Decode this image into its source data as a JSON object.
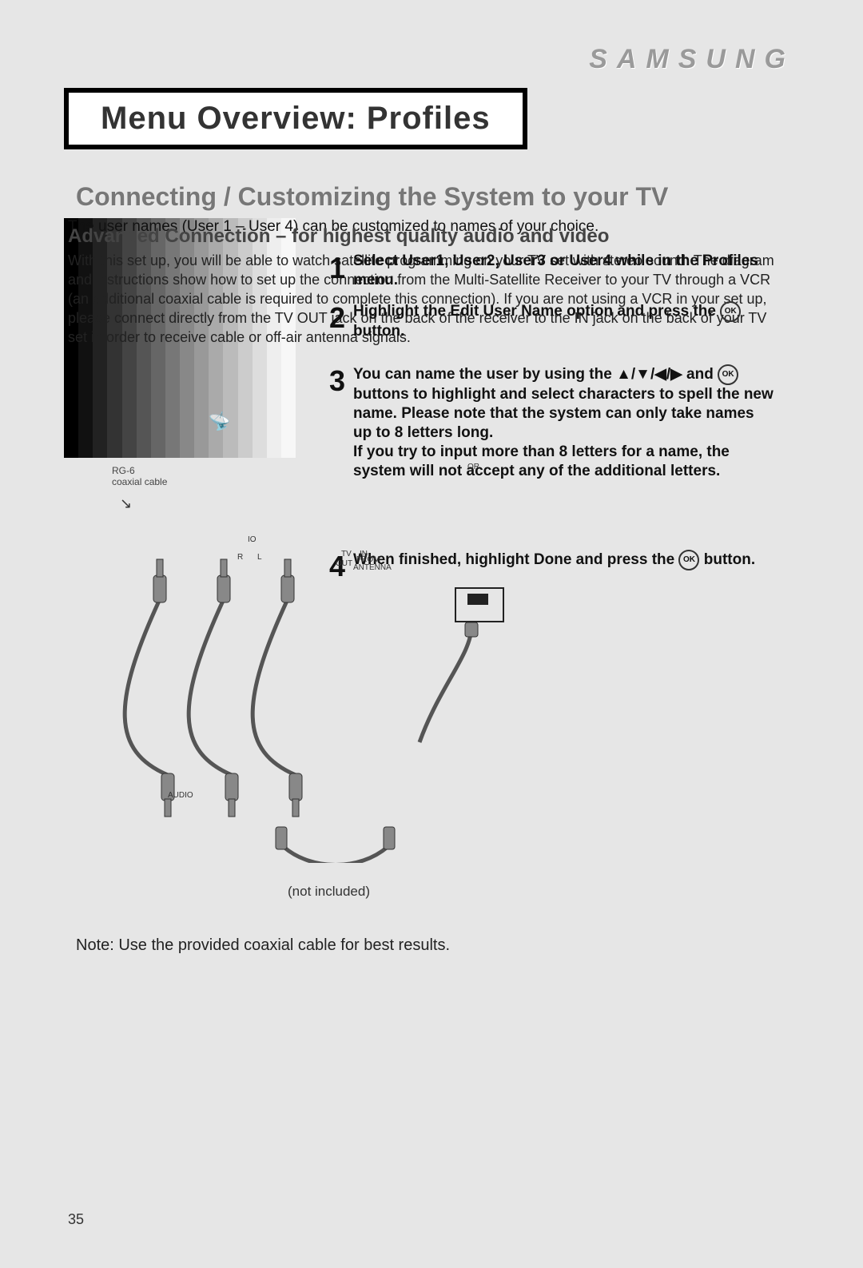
{
  "brand": "SAMSUNG",
  "title": "Menu Overview: Profiles",
  "heading_combined": "Connecting / Customizing the System to your TV",
  "para_overlay_line": "The user names (User 1 – User 4) can be customized to names of your choice.",
  "subheading_overlap": "Advanced Connection – for highest quality audio and video",
  "para_background": "With this set up, you will be able to watch satellite programming on your TV set with stereo sound. The diagram and instructions show how to set up the connection from the Multi-Satellite Receiver to your TV through a VCR (an additional coaxial cable is required to complete this connection). If you are not using a VCR in your set up, please connect directly from the TV OUT jack on the back of the receiver to the IN jack on the back of your TV set in order to receive cable or off-air antenna signals.",
  "steps": {
    "s1_num": "1",
    "s1_txt": "Select User1, User2, User3 or User4 while in the Profiles menu.",
    "s2_num": "2",
    "s2_txt_a": "Highlight the Edit User Name option and press the ",
    "s2_txt_b": " button.",
    "s3_num": "3",
    "s3_txt_a": "You can name the user by using the ▲/▼/◀/▶ and ",
    "s3_txt_b": " buttons to highlight and select characters to spell the new name. Please note that the system can only take names up to 8 letters long.",
    "s3_txt_c": "If you try to input more than 8 letters for a name, the system will not accept any of the additional letters.",
    "s4_num": "4",
    "s4_txt_a": "When finished, highlight Done and press the ",
    "s4_txt_b": " button."
  },
  "labels": {
    "rg6": "RG-6\ncoaxial cable",
    "io": "IO",
    "R": "R",
    "L": "L",
    "audio": "AUDIO",
    "tv": "TV",
    "out": "OUT",
    "in": "IN",
    "from": "FROM",
    "antenna": "ANTENNA",
    "or": "OR",
    "not_included": "(not included)",
    "ok": "OK"
  },
  "note": "Note: Use the provided coaxial cable for best results.",
  "page_number": "35"
}
